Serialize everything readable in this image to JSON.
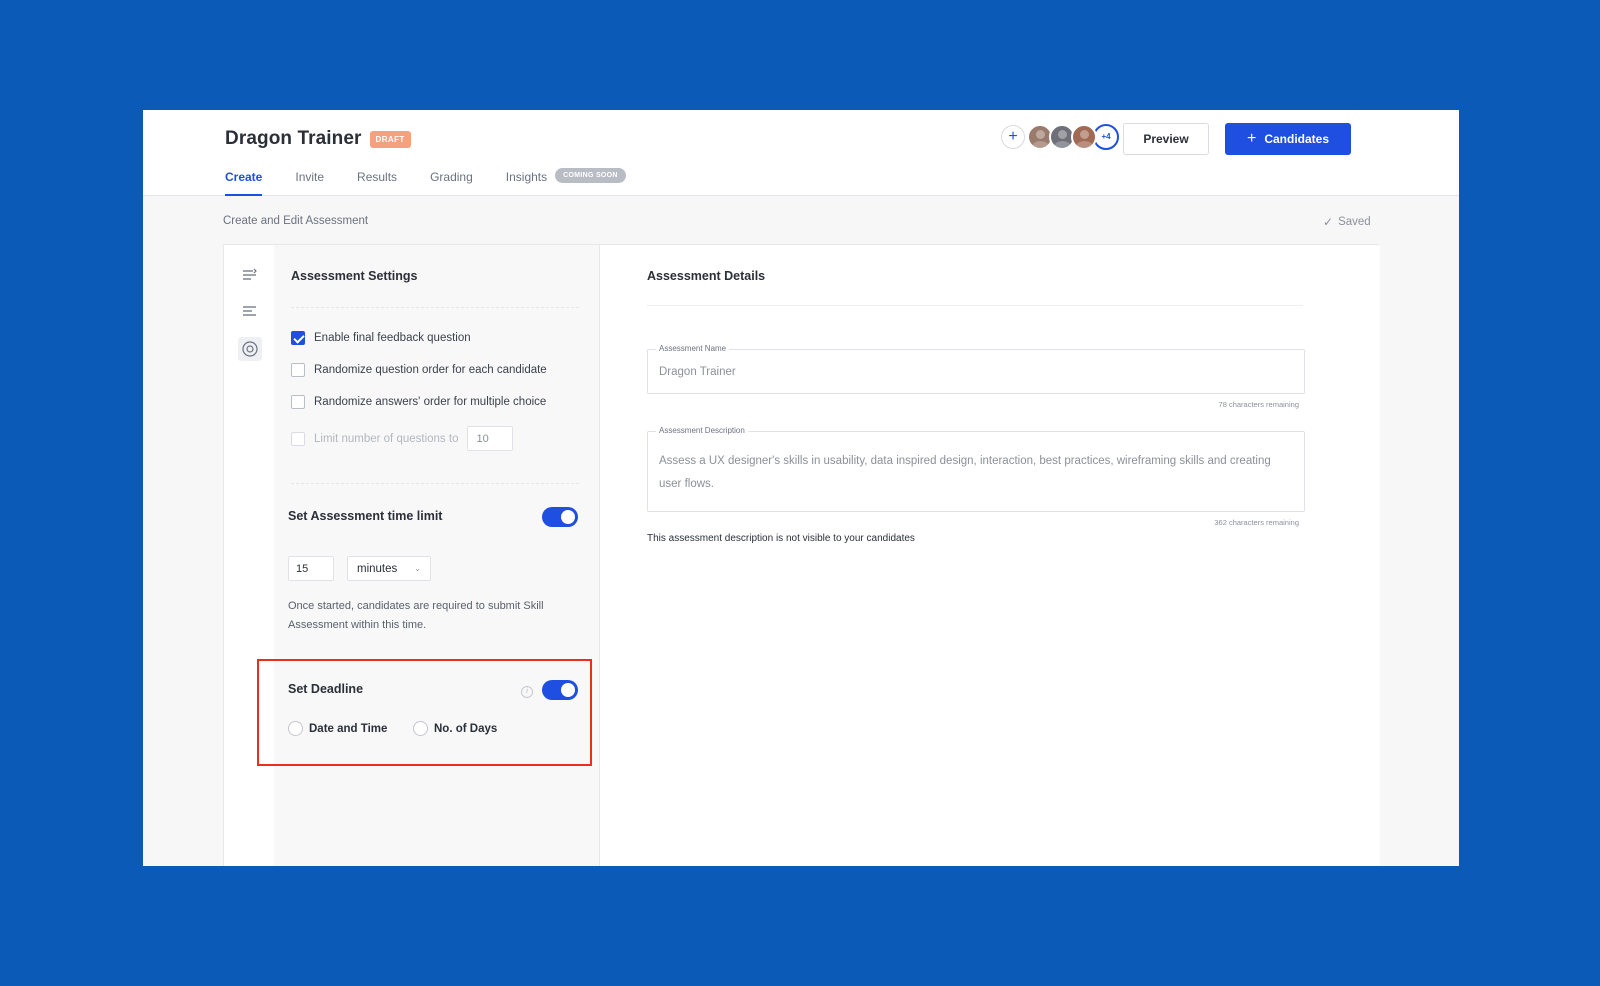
{
  "app": {
    "title": "Dragon Trainer",
    "status_badge": "DRAFT"
  },
  "tabs": [
    {
      "label": "Create",
      "active": true
    },
    {
      "label": "Invite",
      "active": false
    },
    {
      "label": "Results",
      "active": false
    },
    {
      "label": "Grading",
      "active": false
    },
    {
      "label": "Insights",
      "active": false,
      "badge": "COMING SOON"
    }
  ],
  "collaborators": {
    "add_icon": "plus-icon",
    "extra_count": "+4"
  },
  "actions": {
    "preview_label": "Preview",
    "candidates_label": "Candidates"
  },
  "subbar": {
    "title": "Create and Edit Assessment",
    "saved_label": "Saved"
  },
  "rail": {
    "icons": [
      "reorder-icon",
      "list-icon",
      "settings-icon"
    ]
  },
  "settings": {
    "title": "Assessment Settings",
    "options": [
      {
        "label": "Enable final feedback question",
        "checked": true,
        "disabled": false
      },
      {
        "label": "Randomize question order for each candidate",
        "checked": false,
        "disabled": false
      },
      {
        "label": "Randomize answers' order for multiple choice",
        "checked": false,
        "disabled": false
      }
    ],
    "limit": {
      "label": "Limit number of questions to",
      "value": "10",
      "checked": false,
      "disabled": true
    },
    "time_limit": {
      "title": "Set Assessment time limit",
      "enabled": true,
      "value": "15",
      "unit": "minutes",
      "helper": "Once started, candidates are required to submit Skill Assessment within this time."
    },
    "deadline": {
      "title": "Set Deadline",
      "enabled": true,
      "info_icon": "info-icon",
      "options": [
        "Date and Time",
        "No. of Days"
      ]
    }
  },
  "details": {
    "title": "Assessment Details",
    "name_field": {
      "label": "Assessment Name",
      "value": "Dragon Trainer",
      "remaining": "78 characters remaining"
    },
    "description_field": {
      "label": "Assessment Description",
      "value": "Assess a UX designer's skills in usability, data inspired design, interaction, best practices, wireframing skills and creating user flows.",
      "remaining": "362 characters remaining"
    },
    "note": "This assessment description is not visible to your candidates"
  },
  "colors": {
    "background": "#0c5ab8",
    "accent": "#1f4fe0",
    "badge": "#f4a27e",
    "highlight": "#e8301c"
  }
}
